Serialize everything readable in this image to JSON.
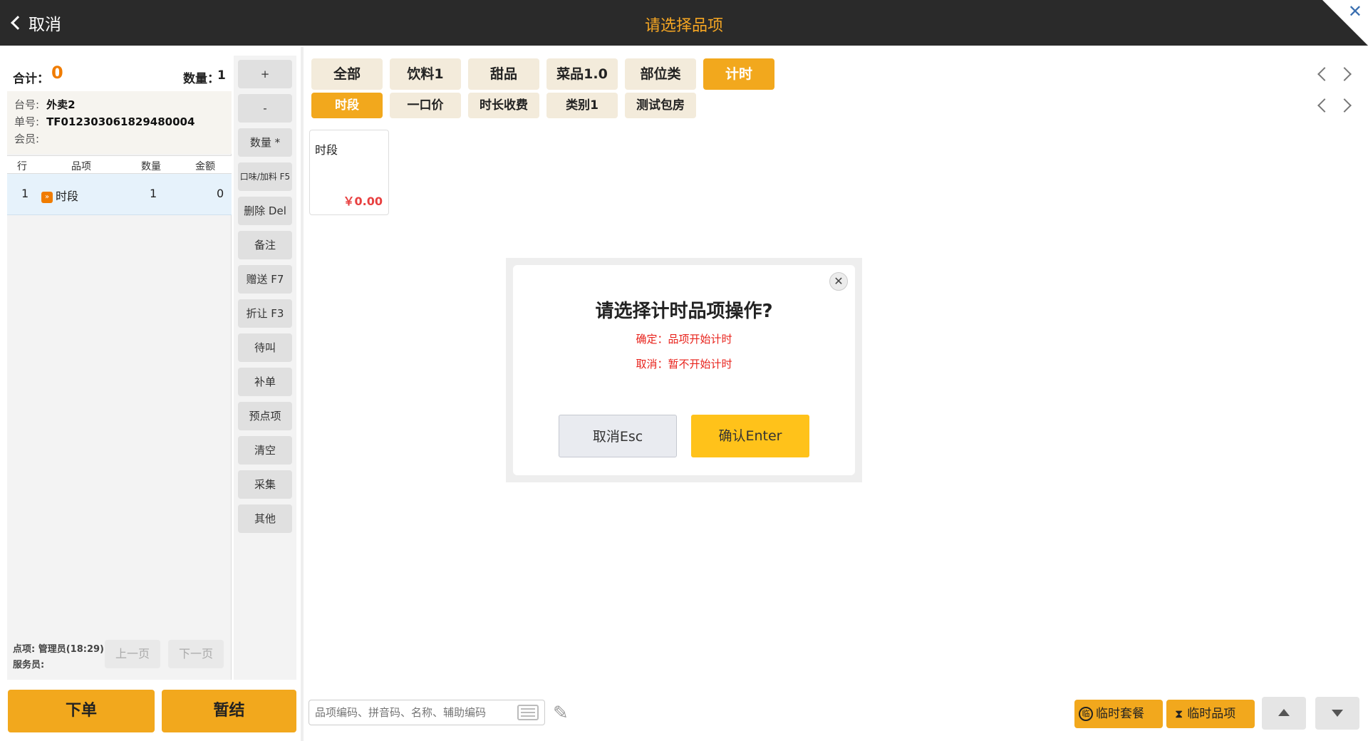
{
  "header": {
    "back_label": "取消",
    "title": "请选择品项",
    "close_glyph": "✕"
  },
  "order": {
    "total_label": "合计：",
    "total_value": "0",
    "qty_label": "数量：",
    "qty_value": "1",
    "table_label": "台号:",
    "table_value": "外卖2",
    "bill_label": "单号:",
    "bill_value": "TF0123030618294800​04",
    "member_label": "会员:",
    "columns": [
      "行",
      "品项",
      "数量",
      "金额"
    ],
    "rows": [
      {
        "line": "1",
        "icon": "»",
        "name": "时段",
        "qty": "1",
        "amount": "0"
      }
    ],
    "orderer_label": "点项:",
    "orderer_value": "管理员(18:29)",
    "waiter_label": "服务员:",
    "prev_page": "上一页",
    "next_page": "下一页"
  },
  "main_buttons": {
    "submit": "下单",
    "hold": "暂结"
  },
  "actions": [
    "+",
    "-",
    "数量 *",
    "口味/加料 F5",
    "删除 Del",
    "备注",
    "赠送 F7",
    "折让 F3",
    "待叫",
    "补单",
    "预点项",
    "清空",
    "采集",
    "其他"
  ],
  "categories": [
    "全部",
    "饮料1",
    "甜品",
    "菜品1.0",
    "部位类",
    "计时"
  ],
  "active_category": "计时",
  "subcategories": [
    "时段",
    "一口价",
    "时长收费",
    "类别1",
    "测试包房"
  ],
  "active_subcategory": "时段",
  "products": [
    {
      "name": "时段",
      "price": "￥0.00"
    }
  ],
  "search": {
    "placeholder": "品项编码、拼音码、名称、辅助编码"
  },
  "toolbar": {
    "temp_combo": "临时套餐",
    "temp_combo_icon": "临",
    "temp_item": "临时品项",
    "temp_item_icon": "⧗"
  },
  "dialog": {
    "title": "请选择计时品项操作?",
    "line1": "确定：品项开始计时",
    "line2": "取消：暂不开始计时",
    "cancel_label": "取消Esc",
    "confirm_label": "确认Enter",
    "close_glyph": "✕"
  },
  "colors": {
    "accent": "#f2a81d",
    "title": "#f5a623",
    "alert": "#e8221b",
    "confirm": "#ffc21a"
  }
}
